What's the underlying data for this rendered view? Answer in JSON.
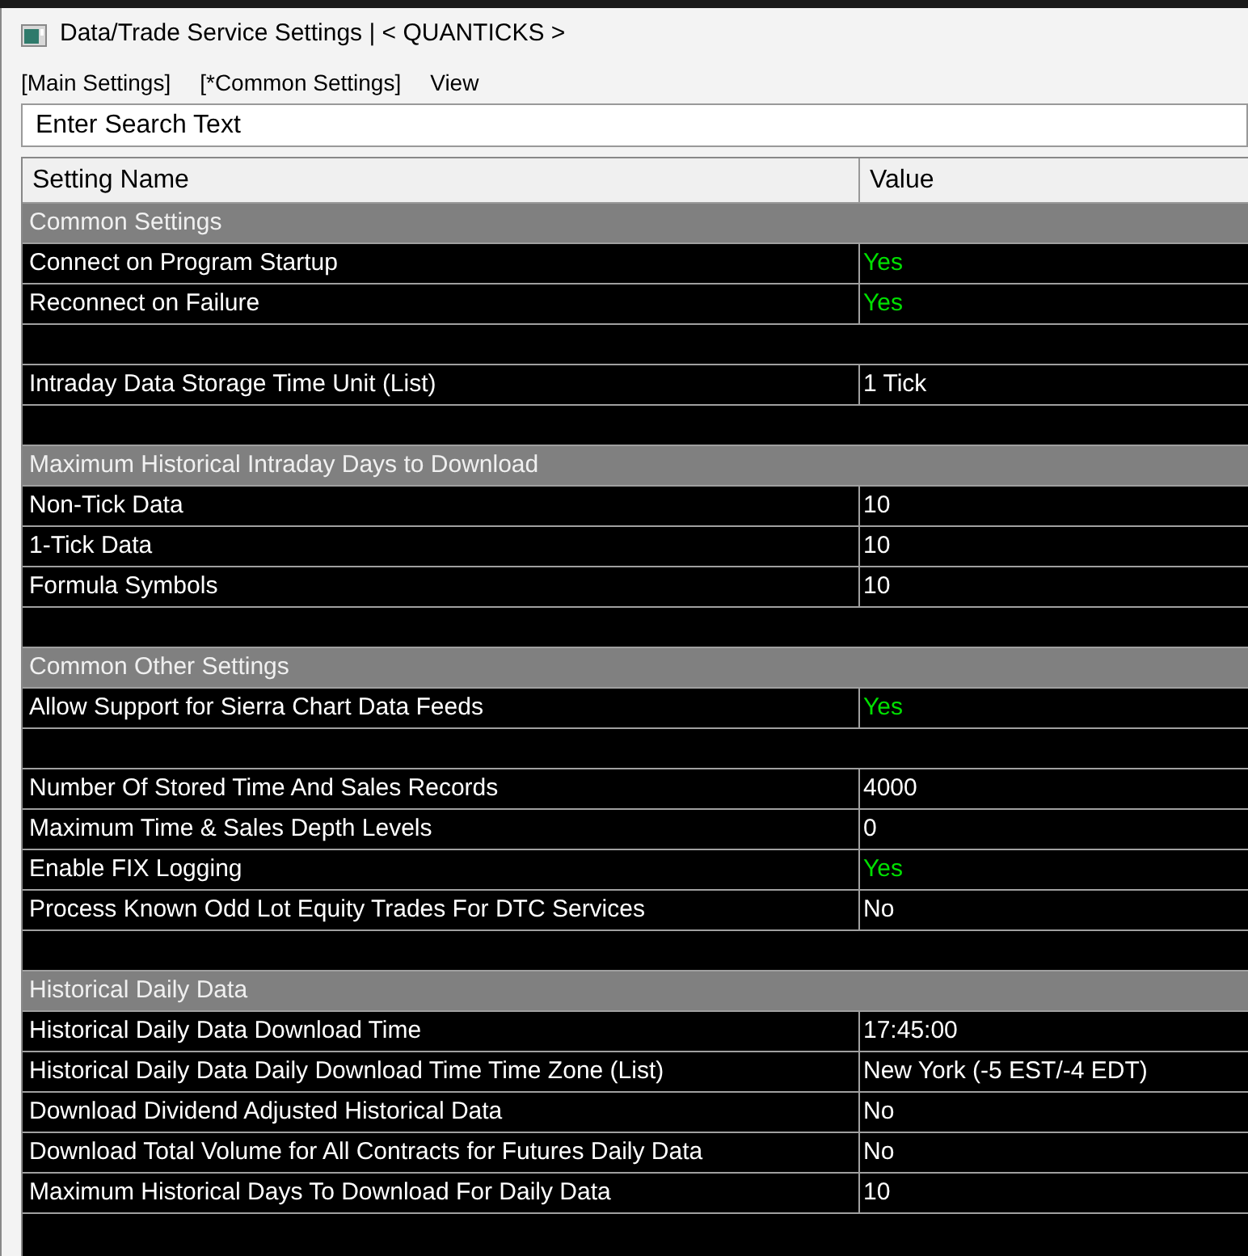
{
  "window": {
    "title": "Data/Trade Service Settings | < QUANTICKS >"
  },
  "menu": [
    {
      "label": "[Main Settings]"
    },
    {
      "label": "[*Common Settings]"
    },
    {
      "label": "View"
    }
  ],
  "search": {
    "placeholder": "Enter Search Text"
  },
  "table": {
    "columns": [
      "Setting Name",
      "Value"
    ],
    "rows": [
      {
        "kind": "section",
        "name": "Common Settings"
      },
      {
        "kind": "setting",
        "name": "Connect on Program Startup",
        "value": "Yes",
        "highlighted": true
      },
      {
        "kind": "setting",
        "name": "Reconnect on Failure",
        "value": "Yes",
        "highlighted": true
      },
      {
        "kind": "blank"
      },
      {
        "kind": "setting",
        "name": "Intraday Data Storage Time Unit (List)",
        "value": "1 Tick",
        "highlighted": false
      },
      {
        "kind": "blank"
      },
      {
        "kind": "section",
        "name": "Maximum Historical Intraday Days to Download"
      },
      {
        "kind": "setting",
        "name": "Non-Tick Data",
        "value": "10",
        "highlighted": false
      },
      {
        "kind": "setting",
        "name": "1-Tick Data",
        "value": "10",
        "highlighted": false
      },
      {
        "kind": "setting",
        "name": "Formula Symbols",
        "value": "10",
        "highlighted": false
      },
      {
        "kind": "blank"
      },
      {
        "kind": "section",
        "name": "Common Other Settings"
      },
      {
        "kind": "setting",
        "name": "Allow Support for Sierra Chart Data Feeds",
        "value": "Yes",
        "highlighted": true
      },
      {
        "kind": "blank"
      },
      {
        "kind": "setting",
        "name": "Number Of Stored Time And Sales Records",
        "value": "4000",
        "highlighted": false
      },
      {
        "kind": "setting",
        "name": "Maximum Time & Sales Depth Levels",
        "value": "0",
        "highlighted": false
      },
      {
        "kind": "setting",
        "name": "Enable FIX Logging",
        "value": "Yes",
        "highlighted": true
      },
      {
        "kind": "setting",
        "name": "Process Known Odd Lot Equity Trades For DTC Services",
        "value": "No",
        "highlighted": false
      },
      {
        "kind": "blank"
      },
      {
        "kind": "section",
        "name": "Historical Daily Data"
      },
      {
        "kind": "setting",
        "name": "Historical Daily Data Download Time",
        "value": "17:45:00",
        "highlighted": false
      },
      {
        "kind": "setting",
        "name": "Historical Daily Data Daily Download Time Time Zone (List)",
        "value": "New York (-5 EST/-4 EDT)",
        "highlighted": false
      },
      {
        "kind": "setting",
        "name": "Download Dividend Adjusted Historical Data",
        "value": "No",
        "highlighted": false
      },
      {
        "kind": "setting",
        "name": "Download Total Volume for All Contracts for Futures Daily Data",
        "value": "No",
        "highlighted": false
      },
      {
        "kind": "setting",
        "name": "Maximum Historical Days To Download For Daily Data",
        "value": "10",
        "highlighted": false
      }
    ]
  }
}
